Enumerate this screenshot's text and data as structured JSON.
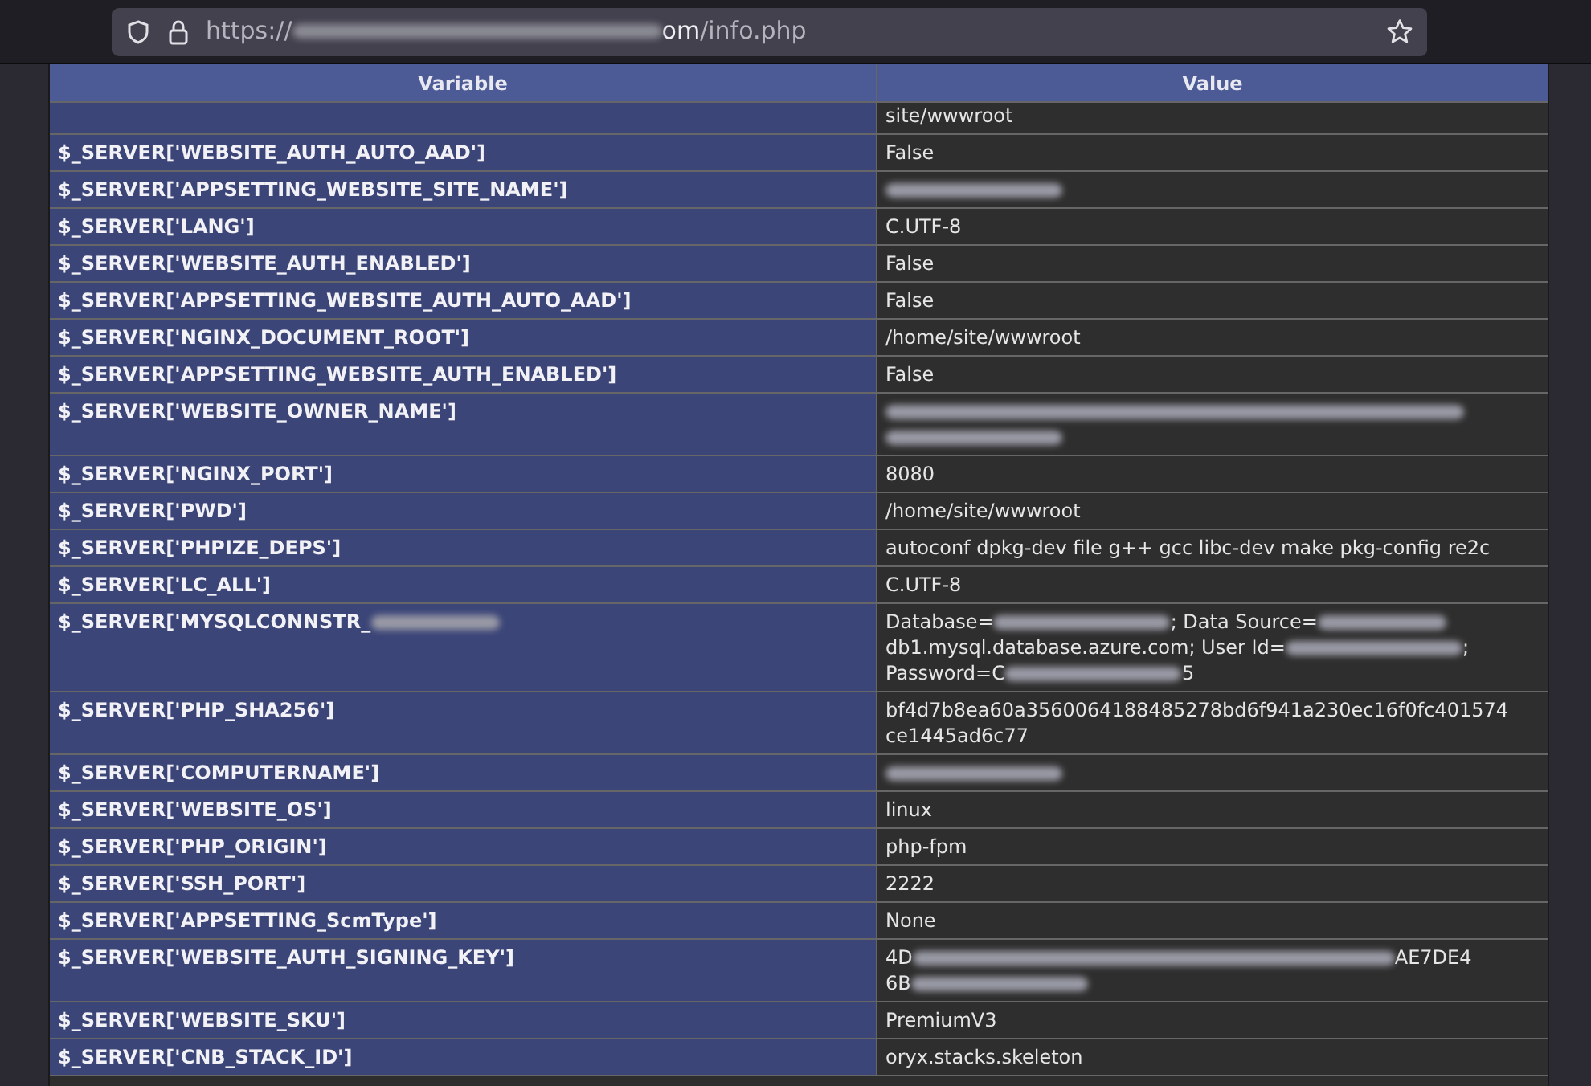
{
  "address_bar": {
    "url_scheme": "https://",
    "url_host": [
      {
        "kind": "redacted_url"
      },
      {
        "kind": "text",
        "text": "om"
      }
    ],
    "url_path": "/info.php"
  },
  "table": {
    "columns": [
      "Variable",
      "Value"
    ],
    "rows": [
      {
        "value": [
          {
            "kind": "text",
            "text": "site/wwwroot"
          }
        ],
        "clipped": true
      },
      {
        "variable": [
          {
            "kind": "text",
            "text": "$_SERVER['WEBSITE_AUTH_AUTO_AAD']"
          }
        ],
        "value": [
          {
            "kind": "text",
            "text": "False"
          }
        ]
      },
      {
        "variable": [
          {
            "kind": "text",
            "text": "$_SERVER['APPSETTING_WEBSITE_SITE_NAME']"
          }
        ],
        "value": [
          {
            "kind": "redacted_medium"
          }
        ]
      },
      {
        "variable": [
          {
            "kind": "text",
            "text": "$_SERVER['LANG']"
          }
        ],
        "value": [
          {
            "kind": "text",
            "text": "C.UTF-8"
          }
        ]
      },
      {
        "variable": [
          {
            "kind": "text",
            "text": "$_SERVER['WEBSITE_AUTH_ENABLED']"
          }
        ],
        "value": [
          {
            "kind": "text",
            "text": "False"
          }
        ]
      },
      {
        "variable": [
          {
            "kind": "text",
            "text": "$_SERVER['APPSETTING_WEBSITE_AUTH_AUTO_AAD']"
          }
        ],
        "value": [
          {
            "kind": "text",
            "text": "False"
          }
        ]
      },
      {
        "variable": [
          {
            "kind": "text",
            "text": "$_SERVER['NGINX_DOCUMENT_ROOT']"
          }
        ],
        "value": [
          {
            "kind": "text",
            "text": "/home/site/wwwroot"
          }
        ]
      },
      {
        "variable": [
          {
            "kind": "text",
            "text": "$_SERVER['APPSETTING_WEBSITE_AUTH_ENABLED']"
          }
        ],
        "value": [
          {
            "kind": "text",
            "text": "False"
          }
        ]
      },
      {
        "variable": [
          {
            "kind": "text",
            "text": "$_SERVER['WEBSITE_OWNER_NAME']"
          }
        ],
        "value": [
          {
            "kind": "redacted_full"
          },
          {
            "kind": "break"
          },
          {
            "kind": "redacted_medium"
          }
        ]
      },
      {
        "variable": [
          {
            "kind": "text",
            "text": "$_SERVER['NGINX_PORT']"
          }
        ],
        "value": [
          {
            "kind": "text",
            "text": "8080"
          }
        ]
      },
      {
        "variable": [
          {
            "kind": "text",
            "text": "$_SERVER['PWD']"
          }
        ],
        "value": [
          {
            "kind": "text",
            "text": "/home/site/wwwroot"
          }
        ]
      },
      {
        "variable": [
          {
            "kind": "text",
            "text": "$_SERVER['PHPIZE_DEPS']"
          }
        ],
        "value": [
          {
            "kind": "text",
            "text": "autoconf dpkg-dev file g++ gcc libc-dev make pkg-config re2c"
          }
        ]
      },
      {
        "variable": [
          {
            "kind": "text",
            "text": "$_SERVER['LC_ALL']"
          }
        ],
        "value": [
          {
            "kind": "text",
            "text": "C.UTF-8"
          }
        ]
      },
      {
        "variable": [
          {
            "kind": "text",
            "text": "$_SERVER['MYSQLCONNSTR_"
          },
          {
            "kind": "redacted_short"
          }
        ],
        "value": [
          {
            "kind": "text",
            "text": "Database="
          },
          {
            "kind": "redacted_medium"
          },
          {
            "kind": "text",
            "text": "; Data Source="
          },
          {
            "kind": "redacted_short"
          },
          {
            "kind": "break"
          },
          {
            "kind": "text",
            "text": "db1.mysql.database.azure.com; User Id="
          },
          {
            "kind": "redacted_medium"
          },
          {
            "kind": "text",
            "text": ";"
          },
          {
            "kind": "break"
          },
          {
            "kind": "text",
            "text": "Password=C"
          },
          {
            "kind": "redacted_medium"
          },
          {
            "kind": "text",
            "text": "5"
          }
        ]
      },
      {
        "variable": [
          {
            "kind": "text",
            "text": "$_SERVER['PHP_SHA256']"
          }
        ],
        "value": [
          {
            "kind": "text",
            "text": "bf4d7b8ea60a3560064188485278bd6f941a230ec16f0fc401574"
          },
          {
            "kind": "break"
          },
          {
            "kind": "text",
            "text": "ce1445ad6c77"
          }
        ]
      },
      {
        "variable": [
          {
            "kind": "text",
            "text": "$_SERVER['COMPUTERNAME']"
          }
        ],
        "value": [
          {
            "kind": "redacted_medium"
          }
        ]
      },
      {
        "variable": [
          {
            "kind": "text",
            "text": "$_SERVER['WEBSITE_OS']"
          }
        ],
        "value": [
          {
            "kind": "text",
            "text": "linux"
          }
        ]
      },
      {
        "variable": [
          {
            "kind": "text",
            "text": "$_SERVER['PHP_ORIGIN']"
          }
        ],
        "value": [
          {
            "kind": "text",
            "text": "php-fpm"
          }
        ]
      },
      {
        "variable": [
          {
            "kind": "text",
            "text": "$_SERVER['SSH_PORT']"
          }
        ],
        "value": [
          {
            "kind": "text",
            "text": "2222"
          }
        ]
      },
      {
        "variable": [
          {
            "kind": "text",
            "text": "$_SERVER['APPSETTING_ScmType']"
          }
        ],
        "value": [
          {
            "kind": "text",
            "text": "None"
          }
        ]
      },
      {
        "variable": [
          {
            "kind": "text",
            "text": "$_SERVER['WEBSITE_AUTH_SIGNING_KEY']"
          }
        ],
        "value": [
          {
            "kind": "text",
            "text": "4D"
          },
          {
            "kind": "redacted_long"
          },
          {
            "kind": "text",
            "text": "AE7DE4"
          },
          {
            "kind": "break"
          },
          {
            "kind": "text",
            "text": "6B"
          },
          {
            "kind": "redacted_medium"
          }
        ]
      },
      {
        "variable": [
          {
            "kind": "text",
            "text": "$_SERVER['WEBSITE_SKU']"
          }
        ],
        "value": [
          {
            "kind": "text",
            "text": "PremiumV3"
          }
        ]
      },
      {
        "variable": [
          {
            "kind": "text",
            "text": "$_SERVER['CNB_STACK_ID']"
          }
        ],
        "value": [
          {
            "kind": "text",
            "text": "oryx.stacks.skeleton"
          }
        ]
      }
    ]
  }
}
